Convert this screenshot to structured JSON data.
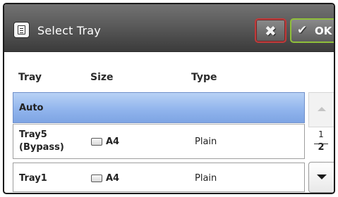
{
  "header": {
    "title": "Select Tray",
    "icon": "tray-document-icon",
    "cancel_icon": "close-icon",
    "ok_icon": "checkmark-icon",
    "ok_label": "OK",
    "cancel_border_color": "#c03a3a",
    "ok_border_color": "#8fbf3a"
  },
  "columns": [
    "Tray",
    "Size",
    "Type"
  ],
  "rows": [
    {
      "tray": "Auto",
      "selected": true
    },
    {
      "tray": "Tray5",
      "tray_sub": "(Bypass)",
      "size": "A4",
      "type": "Plain"
    },
    {
      "tray": "Tray1",
      "size": "A4",
      "type": "Plain"
    }
  ],
  "pagination": {
    "current": "1",
    "total": "2"
  },
  "colors": {
    "header_bg": "#5a5a5a",
    "selected_row": "#8fb3ec"
  }
}
